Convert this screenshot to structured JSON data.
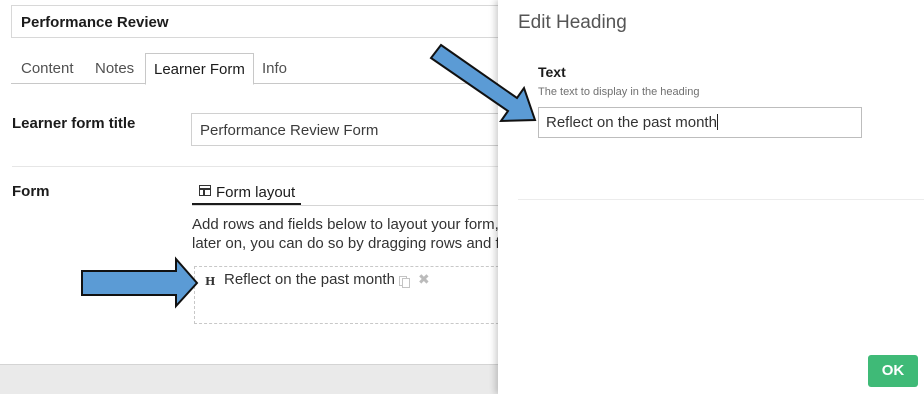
{
  "document": {
    "name": "Performance Review"
  },
  "tabs": [
    {
      "label": "Content"
    },
    {
      "label": "Notes"
    },
    {
      "label": "Learner Form"
    },
    {
      "label": "Info"
    }
  ],
  "learner_form": {
    "title_label": "Learner form title",
    "title_value": "Performance Review Form",
    "form_label": "Form",
    "layout_tab": "Form layout",
    "help_line1": "Add rows and fields below to layout your form,",
    "help_line2": "later on, you can do so by dragging rows and fi",
    "row": {
      "type_marker": "H",
      "text": "Reflect on the past month",
      "icons": [
        "copy-icon",
        "close-icon"
      ]
    }
  },
  "edit_panel": {
    "title": "Edit Heading",
    "field_label": "Text",
    "field_help": "The text to display in the heading",
    "field_value": "Reflect on the past month",
    "ok_label": "OK"
  },
  "colors": {
    "ok_button": "#3fba77",
    "annotation_arrow": "#5b9bd5"
  }
}
